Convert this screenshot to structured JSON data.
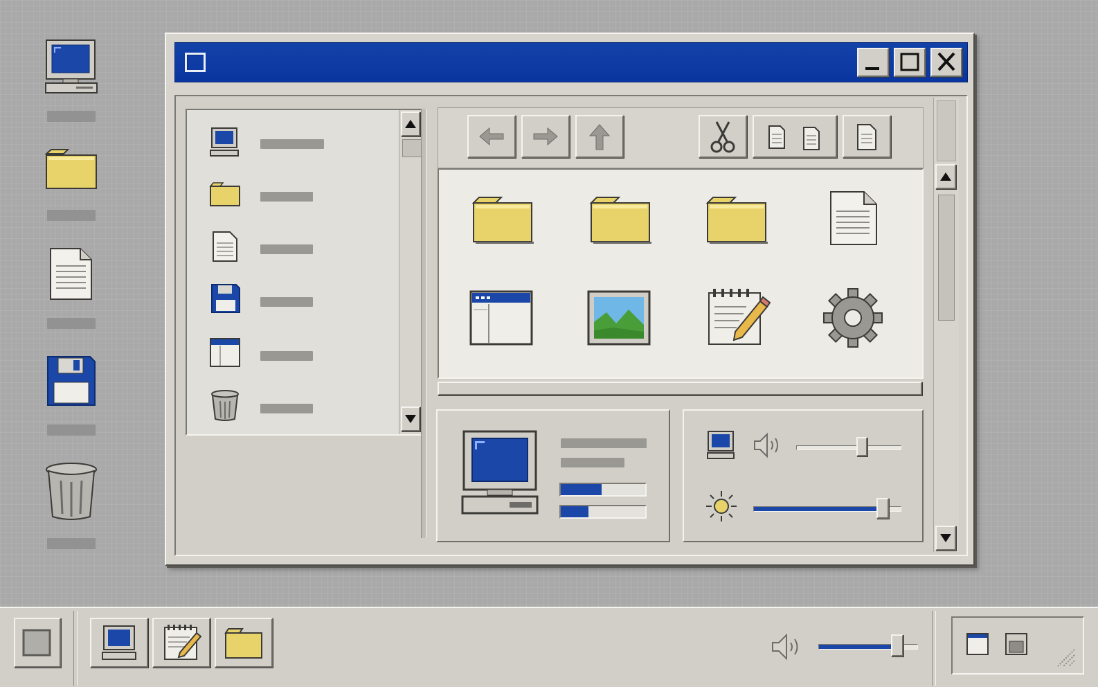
{
  "desktop": {
    "icons": [
      {
        "name": "my-computer-icon"
      },
      {
        "name": "folder-icon"
      },
      {
        "name": "document-icon"
      },
      {
        "name": "floppy-disk-icon"
      },
      {
        "name": "recycle-bin-icon"
      }
    ]
  },
  "window": {
    "titlebar": {
      "system_icon": "window-icon",
      "buttons": [
        "minimize-icon",
        "maximize-icon",
        "close-icon"
      ]
    },
    "sidebar": {
      "items": [
        {
          "icon": "computer-icon"
        },
        {
          "icon": "folder-icon"
        },
        {
          "icon": "document-icon"
        },
        {
          "icon": "floppy-disk-icon"
        },
        {
          "icon": "application-window-icon"
        },
        {
          "icon": "trash-icon"
        }
      ]
    },
    "toolbar": {
      "buttons": [
        "back-arrow-icon",
        "forward-arrow-icon",
        "up-arrow-icon",
        "cut-icon",
        "copy-icon",
        "paste-icon"
      ]
    },
    "file_view": {
      "items": [
        {
          "icon": "folder-icon"
        },
        {
          "icon": "folder-icon"
        },
        {
          "icon": "folder-icon"
        },
        {
          "icon": "document-icon"
        },
        {
          "icon": "application-window-icon"
        },
        {
          "icon": "image-icon"
        },
        {
          "icon": "notepad-icon"
        },
        {
          "icon": "gear-icon"
        }
      ]
    },
    "system_panel": {
      "progress_1": 0.48,
      "progress_2": 0.33
    },
    "controls_panel": {
      "volume_level": 0.63,
      "brightness_level": 0.88
    }
  },
  "taskbar": {
    "start_icon": "start-square-icon",
    "apps": [
      "computer-icon",
      "notepad-icon",
      "folder-icon"
    ],
    "volume_level": 0.8,
    "tray": [
      "window-icon",
      "window-restore-icon"
    ]
  },
  "colors": {
    "titlebar": "#0a35a0",
    "face": "#d1cfc8",
    "accent_blue": "#1a47a8",
    "folder_yellow": "#e8d36b"
  }
}
